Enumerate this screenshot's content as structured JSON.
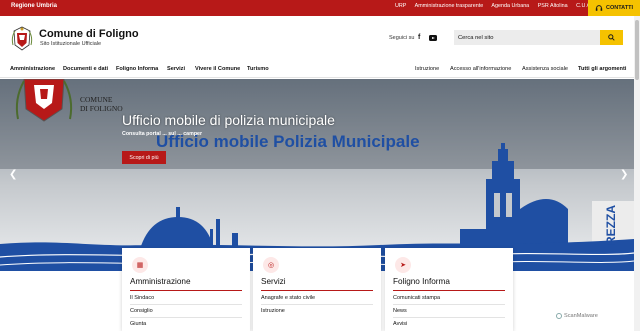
{
  "topbar": {
    "region": "Regione Umbria",
    "links": [
      "URP",
      "Amministrazione trasparente",
      "Agenda Urbana",
      "PSR Altolina",
      "C.U.G."
    ],
    "contact_label": "CONTATTI"
  },
  "header": {
    "title": "Comune di Foligno",
    "subtitle": "Sito Istituzionale Ufficiale",
    "social_label": "Seguici su",
    "search_placeholder": "Cerca nel sito"
  },
  "nav": {
    "left": [
      "Amministrazione",
      "Documenti e dati",
      "Foligno Informa",
      "Servizi",
      "Vivere il Comune",
      "Turismo"
    ],
    "right": [
      "Istruzione",
      "Accesso all'informazione",
      "Assistenza sociale",
      "Tutti gli argomenti"
    ]
  },
  "hero": {
    "title": "Ufficio mobile di polizia municipale",
    "subtitle": "Consulta portal... [partially obscured]",
    "subtitle_visible": "Consulta portal ... sul ... camper",
    "button": "Scopri di più",
    "logo_line1": "COMUNE",
    "logo_line2": "DI FOLIGNO",
    "vehicle_text": "Ufficio mobile Polizia Municipale",
    "side_text": "REZZA"
  },
  "cards": [
    {
      "title": "Amministrazione",
      "items": [
        "Il Sindaco",
        "Consiglio",
        "Giunta"
      ],
      "icon": "calendar-icon"
    },
    {
      "title": "Servizi",
      "items": [
        "Anagrafe e stato civile",
        "Istruzione"
      ],
      "icon": "globe-icon"
    },
    {
      "title": "Foligno Informa",
      "items": [
        "Comunicati stampa",
        "News",
        "Avvisi"
      ],
      "icon": "send-icon"
    }
  ],
  "watermark": "ScanMalware",
  "colors": {
    "brand_red": "#b71918",
    "accent_yellow": "#f5c200",
    "vehicle_blue": "#1f4fa3"
  }
}
